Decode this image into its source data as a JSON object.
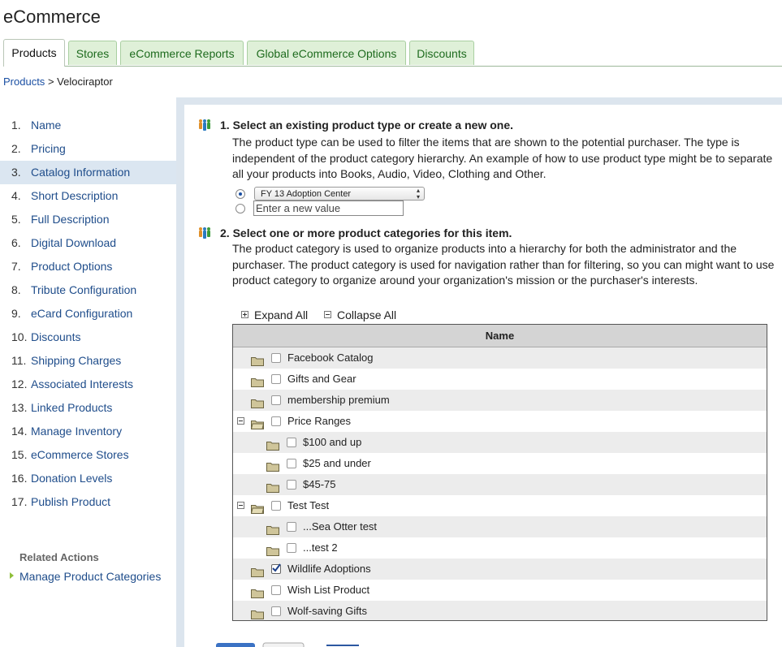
{
  "app": {
    "title": "eCommerce"
  },
  "tabs": [
    {
      "label": "Products",
      "active": true
    },
    {
      "label": "Stores"
    },
    {
      "label": "eCommerce Reports"
    },
    {
      "label": "Global eCommerce Options"
    },
    {
      "label": "Discounts"
    }
  ],
  "breadcrumb": {
    "root": "Products",
    "separator": ">",
    "current": "Velociraptor"
  },
  "nav": {
    "items": [
      {
        "num": "1.",
        "label": "Name"
      },
      {
        "num": "2.",
        "label": "Pricing"
      },
      {
        "num": "3.",
        "label": "Catalog Information",
        "active": true
      },
      {
        "num": "4.",
        "label": "Short Description"
      },
      {
        "num": "5.",
        "label": "Full Description"
      },
      {
        "num": "6.",
        "label": "Digital Download"
      },
      {
        "num": "7.",
        "label": "Product Options"
      },
      {
        "num": "8.",
        "label": "Tribute Configuration"
      },
      {
        "num": "9.",
        "label": "eCard Configuration"
      },
      {
        "num": "10.",
        "label": "Discounts"
      },
      {
        "num": "11.",
        "label": "Shipping Charges"
      },
      {
        "num": "12.",
        "label": "Associated Interests"
      },
      {
        "num": "13.",
        "label": "Linked Products"
      },
      {
        "num": "14.",
        "label": "Manage Inventory"
      },
      {
        "num": "15.",
        "label": "eCommerce Stores"
      },
      {
        "num": "16.",
        "label": "Donation Levels"
      },
      {
        "num": "17.",
        "label": "Publish Product"
      }
    ],
    "related_title": "Related Actions",
    "related_link": "Manage Product Categories"
  },
  "step1": {
    "title": "1. Select an existing product type or create a new one.",
    "description": "The product type can be used to filter the items that are shown to the potential purchaser. The type is independent of the product category hierarchy. An example of how to use product type might be to separate all your products into Books, Audio, Video, Clothing and Other.",
    "select_value": "FY 13 Adoption Center",
    "new_value_placeholder": "Enter a new value"
  },
  "step2": {
    "title": "2. Select one or more product categories for this item.",
    "description": "The product category is used to organize products into a hierarchy for both the administrator and the purchaser. The product category is used for navigation rather than for filtering, so you can might want to use product category to organize around your organization's mission or the purchaser's interests.",
    "expand_all": "Expand All",
    "collapse_all": "Collapse All"
  },
  "tree": {
    "column_header": "Name",
    "rows": [
      {
        "label": "Facebook Catalog",
        "level": 0,
        "checked": false
      },
      {
        "label": "Gifts and Gear",
        "level": 0,
        "checked": false
      },
      {
        "label": "membership premium",
        "level": 0,
        "checked": false
      },
      {
        "label": "Price Ranges",
        "level": 0,
        "checked": false,
        "expanded": true
      },
      {
        "label": "$100 and up",
        "level": 1,
        "checked": false
      },
      {
        "label": "$25 and under",
        "level": 1,
        "checked": false
      },
      {
        "label": "$45-75",
        "level": 1,
        "checked": false
      },
      {
        "label": "Test Test",
        "level": 0,
        "checked": false,
        "expanded": true
      },
      {
        "label": "...Sea Otter test",
        "level": 1,
        "checked": false
      },
      {
        "label": "...test 2",
        "level": 1,
        "checked": false
      },
      {
        "label": "Wildlife Adoptions",
        "level": 0,
        "checked": true
      },
      {
        "label": "Wish List Product",
        "level": 0,
        "checked": false
      },
      {
        "label": "Wolf-saving Gifts",
        "level": 0,
        "checked": false
      }
    ]
  },
  "colors": {
    "accent": "#1f4d8b",
    "tab_bg": "#dff0d8",
    "panel_frame": "#dce5ee",
    "folder": "#cfc59a"
  }
}
